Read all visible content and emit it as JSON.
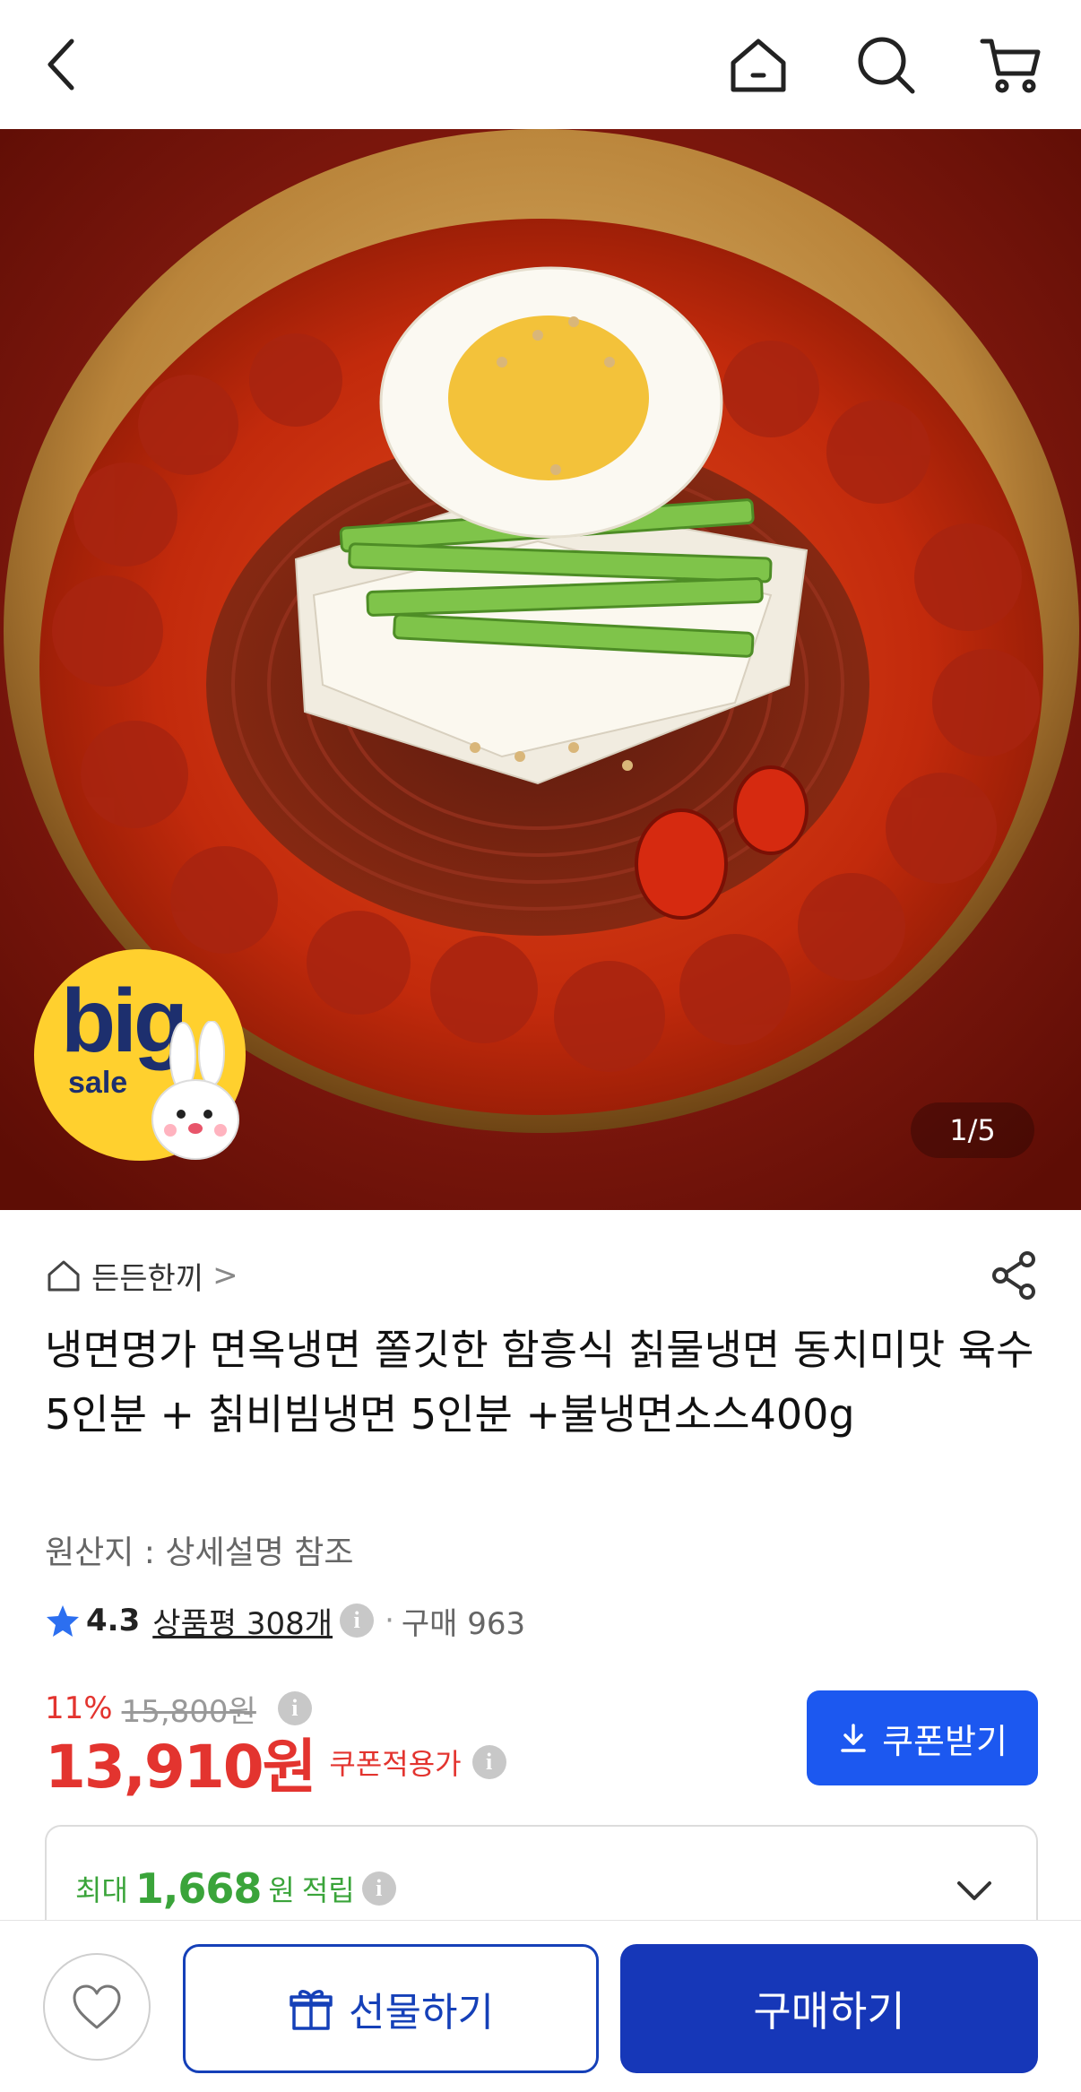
{
  "header": {
    "back_icon": "chevron-left-icon",
    "home_icon": "home-icon",
    "search_icon": "search-icon",
    "cart_icon": "cart-icon"
  },
  "hero": {
    "badge_big": "big",
    "badge_sale": "sale",
    "counter": "1/5"
  },
  "product": {
    "shop_name": "든든한끼",
    "shop_chevron": ">",
    "title": "냉면명가 면옥냉면 쫄깃한 함흥식 칡물냉면 동치미맛 육수 5인분 + 칡비빔냉면 5인분 +불냉면소스400g",
    "origin": "원산지 : 상세설명 참조",
    "rating": "4.3",
    "reviews": "상품평 308개",
    "dot": "·",
    "purchases": "구매 963",
    "info_glyph": "i"
  },
  "pricing": {
    "discount": "11%",
    "original_price": "15,800원",
    "price": "13,910원",
    "coupon_price_label": "쿠폰적용가",
    "coupon_button": "쿠폰받기"
  },
  "reward": {
    "prefix": "최대",
    "amount": "1,668",
    "unit": "원",
    "suffix": "적립"
  },
  "bottom": {
    "gift_button": "선물하기",
    "buy_button": "구매하기"
  },
  "colors": {
    "accent_blue": "#1c58f0",
    "buy_blue": "#1637b8",
    "price_red": "#e3342f",
    "reward_green": "#3aa43a",
    "badge_yellow": "#ffd02e"
  }
}
